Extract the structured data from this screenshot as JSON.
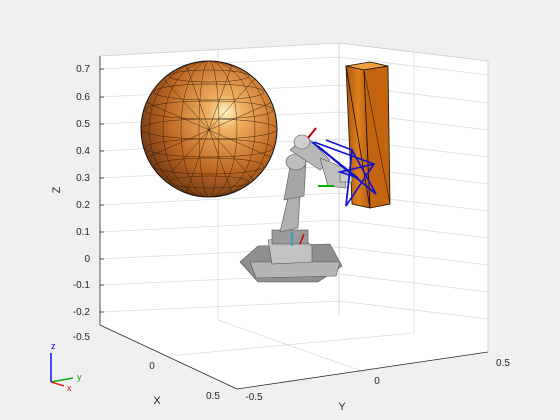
{
  "figure": {
    "background": "#f0f0f0",
    "axes_line_color": "#262626",
    "grid_color": "#d9d9d9"
  },
  "axes3d": {
    "z_axis": {
      "label": "Z",
      "ticks": [
        "0.7",
        "0.6",
        "0.5",
        "0.4",
        "0.3",
        "0.2",
        "0.1",
        "0",
        "-0.1",
        "-0.2",
        "-0.5"
      ]
    },
    "x_axis": {
      "label": "X",
      "ticks": [
        "0",
        "0.5"
      ]
    },
    "y_axis": {
      "label": "Y",
      "ticks": [
        "-0.5",
        "0",
        "0.5"
      ]
    }
  },
  "scene": {
    "sphere_color": "#c8702a",
    "box_color": "#d97a1a",
    "robot_color": "#a8a8a8",
    "trajectory_color": "#1010d0"
  },
  "orientation_triad": {
    "z_label": "z",
    "y_label": "y",
    "x_label": "x",
    "z_color": "#0000ff",
    "y_color": "#00aa00",
    "x_color": "#ff0000"
  }
}
